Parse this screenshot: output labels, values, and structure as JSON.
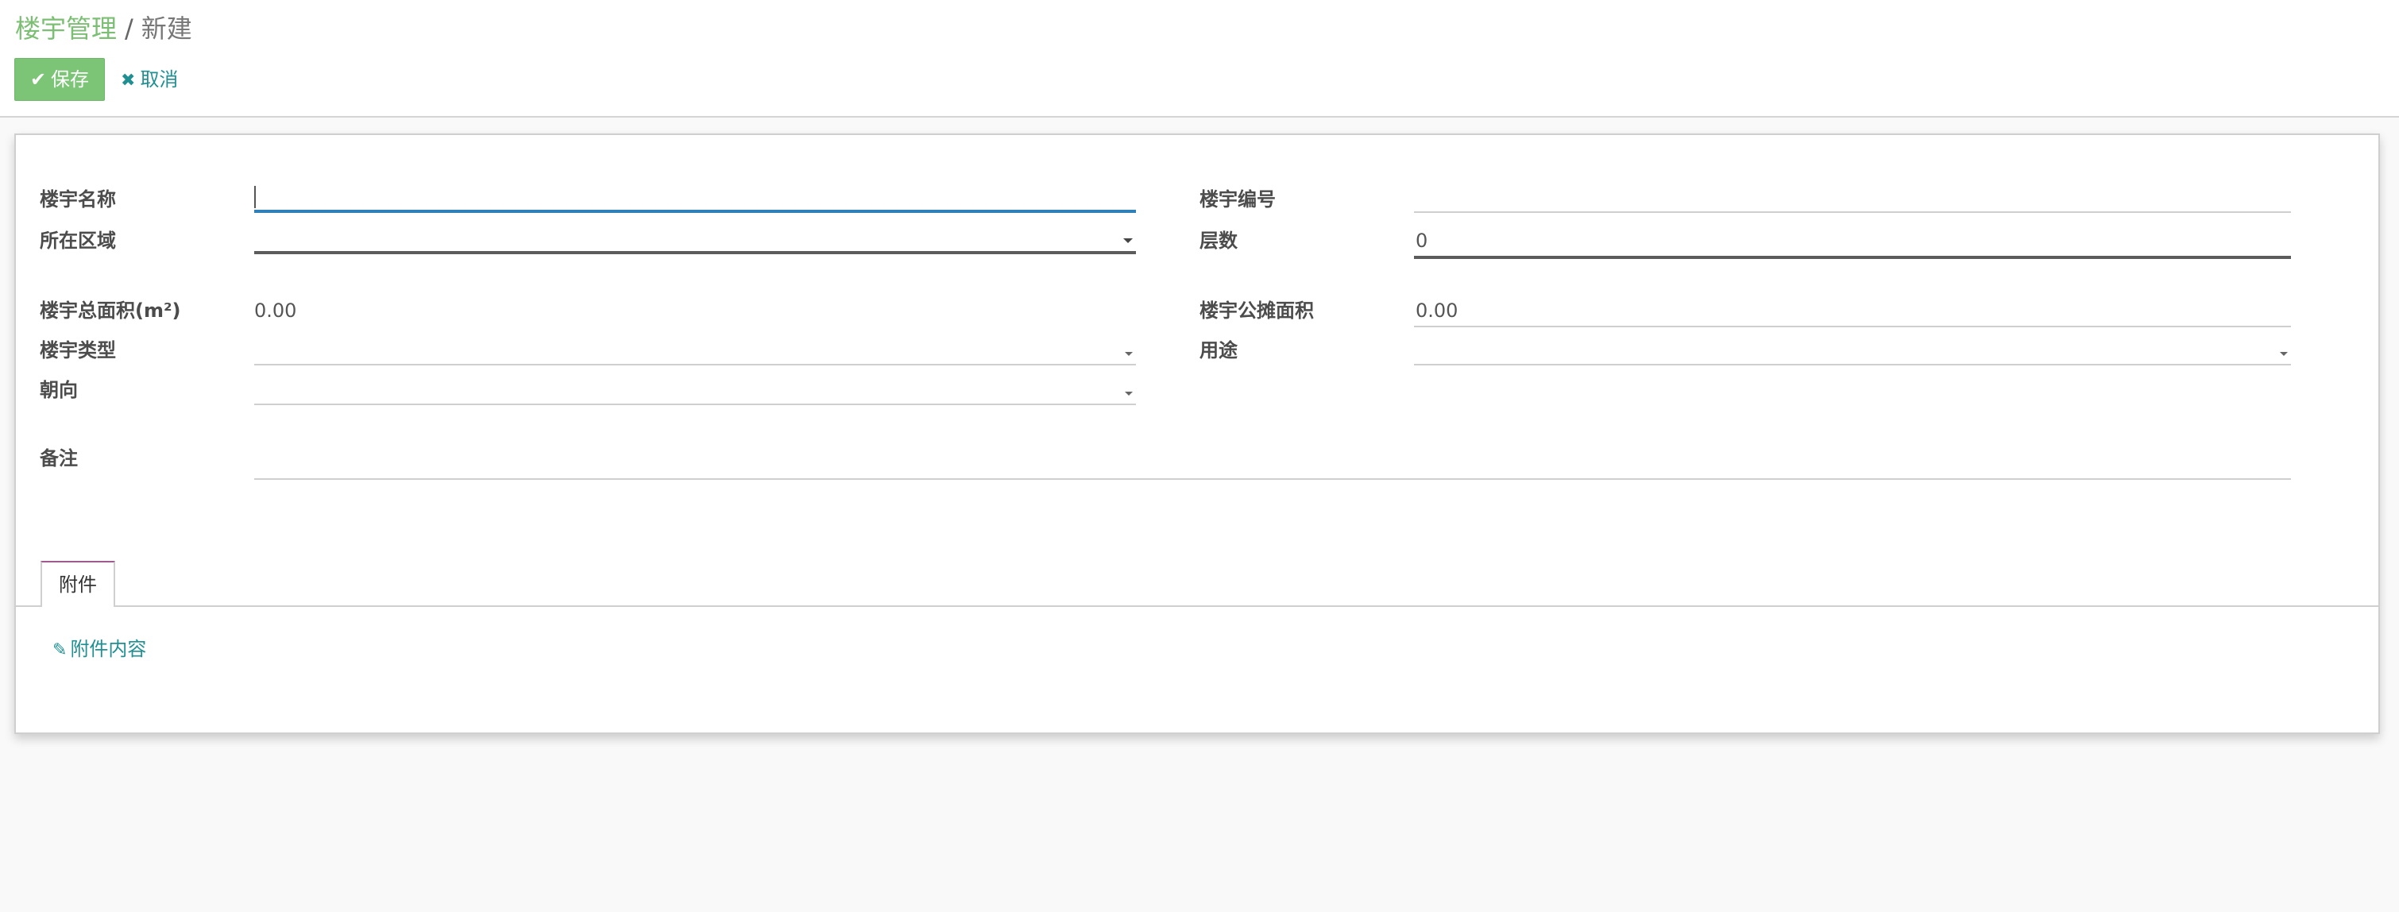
{
  "breadcrumb": {
    "parent": "楼宇管理",
    "separator": "/",
    "current": "新建"
  },
  "toolbar": {
    "save_label": "保存",
    "cancel_label": "取消"
  },
  "form": {
    "building_name": {
      "label": "楼宇名称",
      "value": ""
    },
    "building_code": {
      "label": "楼宇编号",
      "value": ""
    },
    "region": {
      "label": "所在区域",
      "value": ""
    },
    "floors": {
      "label": "层数",
      "value": "0"
    },
    "total_area": {
      "label": "楼宇总面积(m²)",
      "value": "0.00"
    },
    "shared_area": {
      "label": "楼宇公摊面积",
      "value": "0.00"
    },
    "building_type": {
      "label": "楼宇类型",
      "value": ""
    },
    "usage": {
      "label": "用途",
      "value": ""
    },
    "orientation": {
      "label": "朝向",
      "value": ""
    },
    "notes": {
      "label": "备注",
      "value": ""
    }
  },
  "tabs": [
    {
      "label": "附件"
    }
  ],
  "attachments": {
    "link_label": "附件内容"
  },
  "colors": {
    "accent_green": "#7cc576",
    "link_teal": "#1f8f92",
    "focus_blue": "#2f80b8"
  },
  "icons": {
    "save": "check-icon",
    "cancel": "close-icon",
    "attachment": "paperclip-icon"
  }
}
